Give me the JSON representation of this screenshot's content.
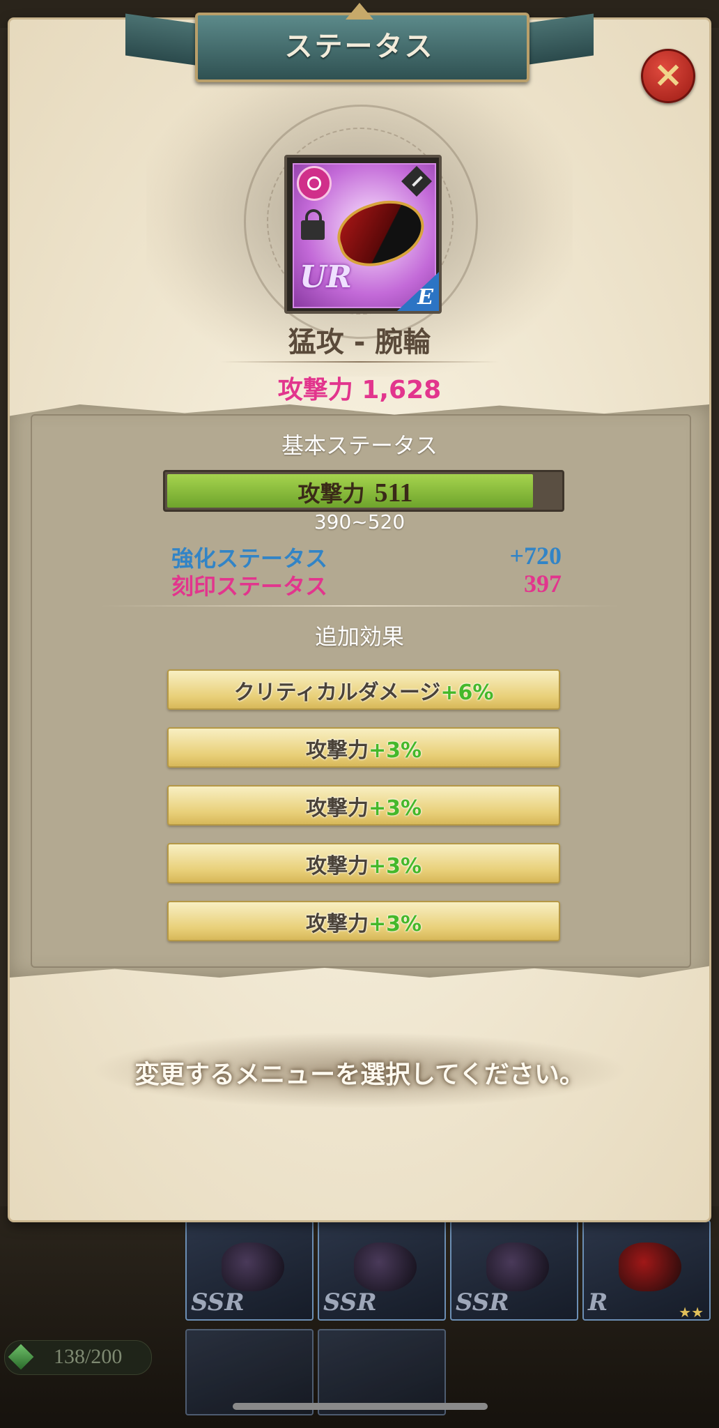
{
  "dialog": {
    "title": "ステータス",
    "close_icon": "close-x-icon"
  },
  "item": {
    "name": "猛攻 - 腕輪",
    "rarity": "UR",
    "grade": "E",
    "attribute_icon": "flame-attribute-icon",
    "type_icon": "sword-type-icon",
    "locked": true,
    "total_attack": "攻撃力 1,628"
  },
  "base_status": {
    "title": "基本ステータス",
    "stat_label": "攻撃力",
    "stat_value": "511",
    "fill_fraction": 0.93,
    "range": "390~520",
    "enhance_label": "強化ステータス",
    "enhance_value": "+720",
    "engrave_label": "刻印ステータス",
    "engrave_value": "397"
  },
  "additional_effects": {
    "title": "追加効果",
    "items": [
      {
        "name": "クリティカルダメージ",
        "value": "+6%"
      },
      {
        "name": "攻撃力",
        "value": "+3%"
      },
      {
        "name": "攻撃力",
        "value": "+3%"
      },
      {
        "name": "攻撃力",
        "value": "+3%"
      },
      {
        "name": "攻撃力",
        "value": "+3%"
      }
    ]
  },
  "prompt": "変更するメニューを選択してください。",
  "inventory": {
    "count": "138/200",
    "slots": [
      "SSR",
      "SSR",
      "SSR",
      "R"
    ]
  },
  "colors": {
    "accent_pink": "#e2358d",
    "accent_blue": "#3284c6",
    "bonus_green": "#45b82a",
    "bar_green": "#8cc63f"
  }
}
